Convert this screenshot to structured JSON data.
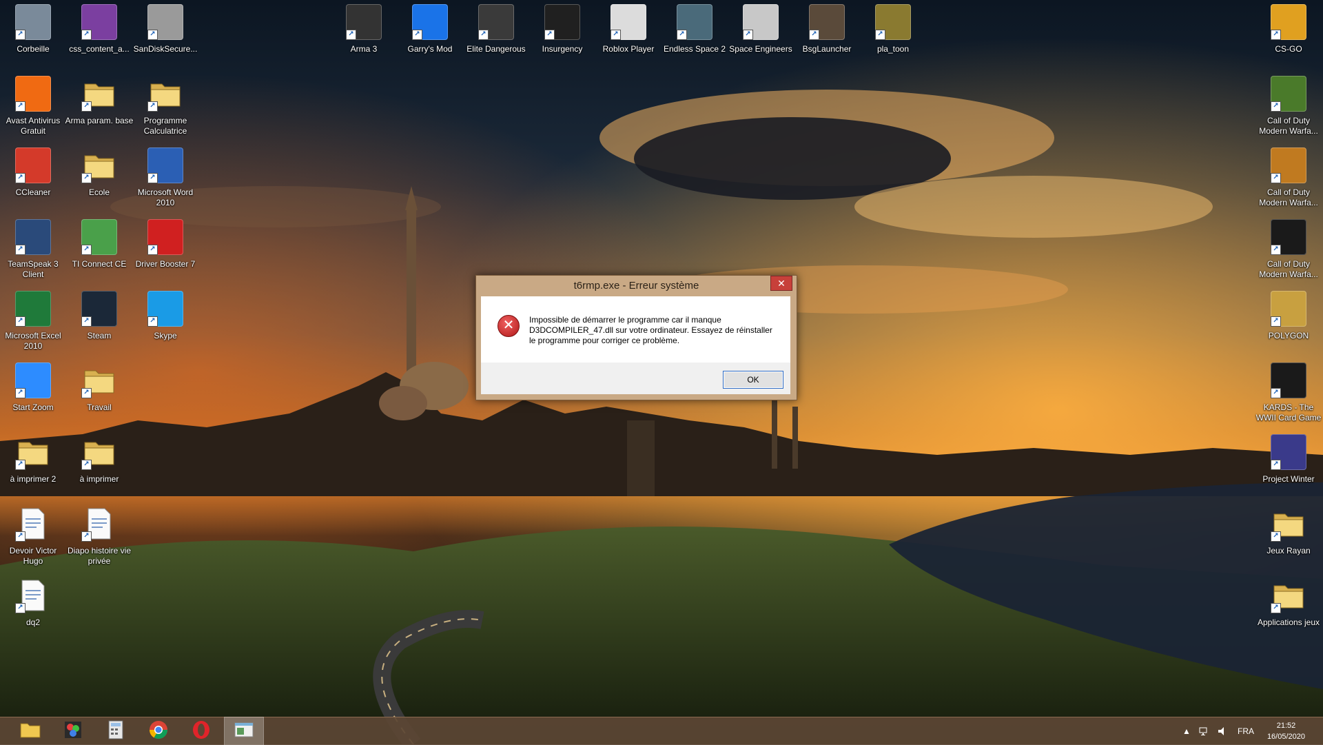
{
  "desktop": {
    "icons_left": [
      {
        "label": "Corbeille",
        "icon": "recycle-bin-icon",
        "color": "#7a8a9a"
      },
      {
        "label": "css_content_a...",
        "icon": "winrar-archive-icon",
        "color": "#7b3fa0"
      },
      {
        "label": "SanDiskSecure...",
        "icon": "sandisk-vault-icon",
        "color": "#9a9a9a"
      },
      {
        "label": "Avast Antivirus Gratuit",
        "icon": "avast-icon",
        "color": "#f06a12"
      },
      {
        "label": "Arma param. base",
        "icon": "folder-icon",
        "color": "#e8c860"
      },
      {
        "label": "Programme Calculatrice",
        "icon": "folder-icon",
        "color": "#e8c860"
      },
      {
        "label": "CCleaner",
        "icon": "ccleaner-icon",
        "color": "#d43a2a"
      },
      {
        "label": "Ecole",
        "icon": "folder-icon",
        "color": "#e8c860"
      },
      {
        "label": "Microsoft Word 2010",
        "icon": "word-icon",
        "color": "#2b5fb4"
      },
      {
        "label": "TeamSpeak 3 Client",
        "icon": "teamspeak-icon",
        "color": "#2a4a7a"
      },
      {
        "label": "TI Connect CE",
        "icon": "ti-connect-icon",
        "color": "#4aa04a"
      },
      {
        "label": "Driver Booster 7",
        "icon": "driver-booster-icon",
        "color": "#d02020"
      },
      {
        "label": "Microsoft Excel 2010",
        "icon": "excel-icon",
        "color": "#1f7a3a"
      },
      {
        "label": "Steam",
        "icon": "steam-icon",
        "color": "#1b2838"
      },
      {
        "label": "Skype",
        "icon": "skype-icon",
        "color": "#1a9be6"
      },
      {
        "label": "Start Zoom",
        "icon": "zoom-icon",
        "color": "#2d8cff"
      },
      {
        "label": "Travail",
        "icon": "folder-icon",
        "color": "#e8c860"
      },
      {
        "label": "à imprimer 2",
        "icon": "folder-icon",
        "color": "#e8c860"
      },
      {
        "label": "à imprimer",
        "icon": "folder-icon",
        "color": "#e8c860"
      },
      {
        "label": "Devoir Victor Hugo",
        "icon": "document-icon",
        "color": "#f4f4f4"
      },
      {
        "label": "Diapo histoire vie privée",
        "icon": "presentation-icon",
        "color": "#f4f4f4"
      },
      {
        "label": "dq2",
        "icon": "word-document-icon",
        "color": "#f4f4f4"
      }
    ],
    "icons_top": [
      {
        "label": "Arma 3",
        "icon": "arma3-icon",
        "color": "#333333"
      },
      {
        "label": "Garry's Mod",
        "icon": "garrys-mod-icon",
        "color": "#1a73e8"
      },
      {
        "label": "Elite Dangerous",
        "icon": "elite-dangerous-icon",
        "color": "#3a3a3a"
      },
      {
        "label": "Insurgency",
        "icon": "insurgency-icon",
        "color": "#202020"
      },
      {
        "label": "Roblox Player",
        "icon": "roblox-icon",
        "color": "#dcdcdc"
      },
      {
        "label": "Endless Space 2",
        "icon": "endless-space-2-icon",
        "color": "#4a6a7a"
      },
      {
        "label": "Space Engineers",
        "icon": "space-engineers-icon",
        "color": "#c8c8c8"
      },
      {
        "label": "BsgLauncher",
        "icon": "bsg-launcher-icon",
        "color": "#5a4a3a"
      },
      {
        "label": "pla_toon",
        "icon": "plarium-toon-icon",
        "color": "#8a7a30"
      }
    ],
    "icons_right": [
      {
        "label": "CS-GO",
        "icon": "csgo-icon",
        "color": "#e0a020"
      },
      {
        "label": "Call of Duty Modern Warfa...",
        "icon": "cod-mw2-icon",
        "color": "#4a7a2a"
      },
      {
        "label": "Call of Duty Modern Warfa...",
        "icon": "cod-mw2-icon",
        "color": "#c07a20"
      },
      {
        "label": "Call of Duty Modern Warfa...",
        "icon": "cod-mw-icon",
        "color": "#1a1a1a"
      },
      {
        "label": "POLYGON",
        "icon": "polygon-icon",
        "color": "#c8a040"
      },
      {
        "label": "KARDS - The WWII Card Game",
        "icon": "kards-icon",
        "color": "#1a1a1a"
      },
      {
        "label": "Project Winter",
        "icon": "project-winter-icon",
        "color": "#3a3a8a"
      },
      {
        "label": "Jeux Rayan",
        "icon": "folder-icon",
        "color": "#e8c860"
      },
      {
        "label": "Applications jeux",
        "icon": "folder-icon",
        "color": "#e8c860"
      }
    ]
  },
  "dialog": {
    "title": "t6rmp.exe - Erreur système",
    "close_glyph": "✕",
    "error_glyph": "✕",
    "message": "Impossible de démarrer le programme car il manque D3DCOMPILER_47.dll sur votre ordinateur. Essayez de réinstaller le programme pour corriger ce problème.",
    "ok_label": "OK"
  },
  "taskbar": {
    "apps": [
      {
        "name": "file-explorer",
        "icon": "folder-icon",
        "active": false
      },
      {
        "name": "photos",
        "icon": "photos-icon",
        "active": false
      },
      {
        "name": "calculator",
        "icon": "calculator-icon",
        "active": false
      },
      {
        "name": "chrome",
        "icon": "chrome-icon",
        "active": false
      },
      {
        "name": "opera",
        "icon": "opera-icon",
        "active": false
      },
      {
        "name": "error-window",
        "icon": "window-icon",
        "active": true
      }
    ],
    "tray": {
      "language": "FRA",
      "time": "21:52",
      "date": "16/05/2020"
    }
  }
}
